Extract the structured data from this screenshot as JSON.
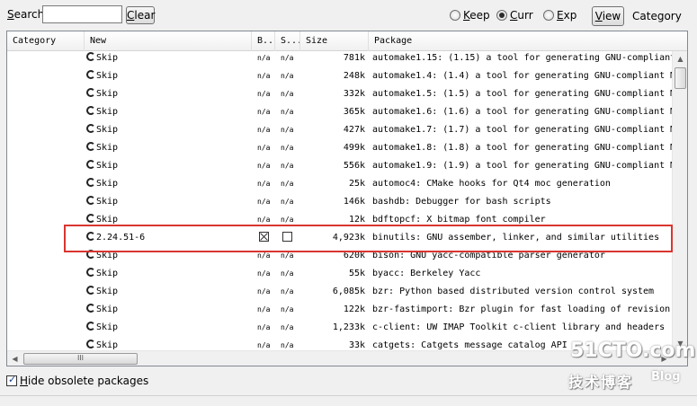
{
  "toolbar": {
    "search_label_u": "S",
    "search_label_rest": "earch",
    "search_value": "",
    "clear_label_u": "C",
    "clear_label_rest": "lear",
    "radios": [
      {
        "u": "K",
        "rest": "eep",
        "checked": false
      },
      {
        "u": "C",
        "rest": "urr",
        "checked": true
      },
      {
        "u": "E",
        "rest": "xp",
        "checked": false
      }
    ],
    "view_label_u": "V",
    "view_label_rest": "iew",
    "view_mode": "Category"
  },
  "columns": {
    "category": "Category",
    "new": "New",
    "bin": "B...",
    "src": "S...",
    "size": "Size",
    "package": "Package"
  },
  "rows": [
    {
      "new": "Skip",
      "bin": "n/a",
      "src": "n/a",
      "size": "781k",
      "package": "automake1.15: (1.15) a tool for generating GNU-compliant"
    },
    {
      "new": "Skip",
      "bin": "n/a",
      "src": "n/a",
      "size": "248k",
      "package": "automake1.4: (1.4) a tool for generating GNU-compliant M"
    },
    {
      "new": "Skip",
      "bin": "n/a",
      "src": "n/a",
      "size": "332k",
      "package": "automake1.5: (1.5) a tool for generating GNU-compliant M"
    },
    {
      "new": "Skip",
      "bin": "n/a",
      "src": "n/a",
      "size": "365k",
      "package": "automake1.6: (1.6) a tool for generating GNU-compliant M"
    },
    {
      "new": "Skip",
      "bin": "n/a",
      "src": "n/a",
      "size": "427k",
      "package": "automake1.7: (1.7) a tool for generating GNU-compliant M"
    },
    {
      "new": "Skip",
      "bin": "n/a",
      "src": "n/a",
      "size": "499k",
      "package": "automake1.8: (1.8) a tool for generating GNU-compliant M"
    },
    {
      "new": "Skip",
      "bin": "n/a",
      "src": "n/a",
      "size": "556k",
      "package": "automake1.9: (1.9) a tool for generating GNU-compliant M"
    },
    {
      "new": "Skip",
      "bin": "n/a",
      "src": "n/a",
      "size": "25k",
      "package": "automoc4: CMake hooks for Qt4 moc generation"
    },
    {
      "new": "Skip",
      "bin": "n/a",
      "src": "n/a",
      "size": "146k",
      "package": "bashdb: Debugger for bash scripts"
    },
    {
      "new": "Skip",
      "bin": "n/a",
      "src": "n/a",
      "size": "12k",
      "package": "bdftopcf: X bitmap font compiler"
    },
    {
      "new": "2.24.51-6",
      "bin": "checked",
      "src": "unchecked",
      "size": "4,923k",
      "package": "binutils: GNU assember, linker, and similar utilities"
    },
    {
      "new": "Skip",
      "bin": "n/a",
      "src": "n/a",
      "size": "620k",
      "package": "bison: GNU yacc-compatible parser generator"
    },
    {
      "new": "Skip",
      "bin": "n/a",
      "src": "n/a",
      "size": "55k",
      "package": "byacc: Berkeley Yacc"
    },
    {
      "new": "Skip",
      "bin": "n/a",
      "src": "n/a",
      "size": "6,085k",
      "package": "bzr: Python based distributed version control system"
    },
    {
      "new": "Skip",
      "bin": "n/a",
      "src": "n/a",
      "size": "122k",
      "package": "bzr-fastimport: Bzr plugin for fast loading of revision"
    },
    {
      "new": "Skip",
      "bin": "n/a",
      "src": "n/a",
      "size": "1,233k",
      "package": "c-client: UW IMAP Toolkit c-client library and headers"
    },
    {
      "new": "Skip",
      "bin": "n/a",
      "src": "n/a",
      "size": "33k",
      "package": "catgets: Catgets message catalog API"
    }
  ],
  "scroll_thumb_grip": "III",
  "hide_obsolete": {
    "u": "H",
    "rest": "ide obsolete packages",
    "checked": true
  },
  "watermark": {
    "main": "51CTO.com",
    "sub": "技术博客",
    "blog": "Blog"
  },
  "colors": {
    "highlight_border": "#d9352f",
    "grid_border": "#828790",
    "window_bg": "#f0f0f0"
  }
}
